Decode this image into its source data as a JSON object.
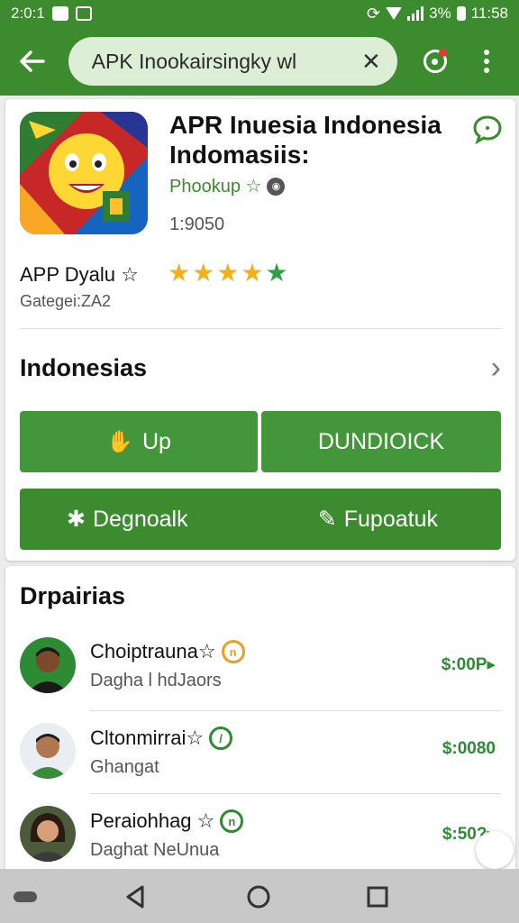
{
  "status_bar": {
    "time_left": "2:0:1",
    "battery": "3%",
    "clock": "11:58"
  },
  "app_bar": {
    "search_value": "APK Inookairsingky wl",
    "clear_label": "✕"
  },
  "app": {
    "title": "APR Inuesia Indonesia Indomasiis:",
    "developer": "Phookup ☆",
    "count": "1:9050",
    "subtitle": "APP Dyalu ☆",
    "category": "Gategei:ZA2",
    "rating_stars": 5,
    "section_label": "Indonesias",
    "btn_up_label": "Up",
    "btn_download_label": "DUNDIOICK",
    "btn_left_label": "Degnoalk",
    "btn_right_label": "Fupoatuk"
  },
  "list": {
    "title": "Drpairias",
    "items": [
      {
        "name": "Choiptrauna☆",
        "sub": "Dagha l hdJaors",
        "price": "$:00P▸",
        "badge_color": "#e8a020",
        "badge_glyph": "n"
      },
      {
        "name": "Cltonmirrai☆",
        "sub": "Ghangat",
        "price": "$:0080",
        "badge_color": "#2e8b35",
        "badge_glyph": "/"
      },
      {
        "name": "Peraiohhag ☆",
        "sub": "Daghat NeUnua",
        "price": "$:50?▸",
        "badge_color": "#2e8b35",
        "badge_glyph": "n"
      }
    ]
  },
  "colors": {
    "primary": "#3d8b2f",
    "button": "#43963a",
    "price": "#2e8b35",
    "star": "#f2b01e"
  }
}
